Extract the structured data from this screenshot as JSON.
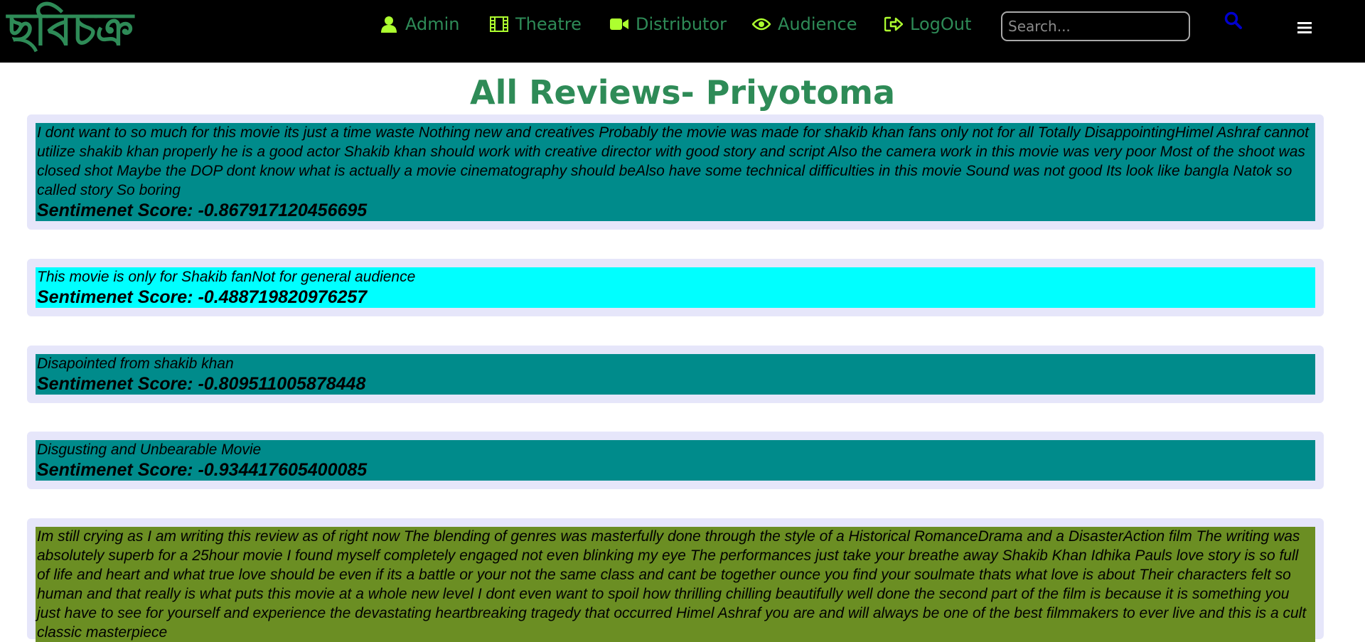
{
  "navbar": {
    "logo": "ছবিচক্র",
    "items": [
      {
        "label": "Admin",
        "icon": "user-icon"
      },
      {
        "label": "Theatre",
        "icon": "film-icon"
      },
      {
        "label": "Distributor",
        "icon": "video-camera-icon"
      },
      {
        "label": "Audience",
        "icon": "eye-icon"
      },
      {
        "label": "LogOut",
        "icon": "sign-out-icon"
      }
    ],
    "search": {
      "placeholder": "Search...",
      "value": ""
    },
    "search_button_icon": "search-icon",
    "menu_icon": "hamburger-menu-icon"
  },
  "page": {
    "title": "All Reviews- Priyotoma"
  },
  "score_label": "Sentimenet Score:",
  "reviews": [
    {
      "text": "I dont want to so much for this movie its just a time waste Nothing new and creatives Probably the movie was made for shakib khan fans only not for all Totally DisappointingHimel Ashraf cannot utilize shakib khan properly he is a good actor Shakib khan should work with creative director with good story and script Also the camera work in this movie was very poor Most of the shoot was closed shot Maybe the DOP dont know what is actually a movie cinematography should beAlso have some technical difficulties in this movie Sound was not good Its look like bangla Natok so called story So boring",
      "score": "-0.867917120456695",
      "color": "#008b8b"
    },
    {
      "text": "This movie is only for Shakib fanNot for general audience",
      "score": "-0.488719820976257",
      "color": "#00ffff"
    },
    {
      "text": "Disapointed from shakib khan",
      "score": "-0.809511005878448",
      "color": "#008b8b"
    },
    {
      "text": "Disgusting and Unbearable Movie",
      "score": "-0.934417605400085",
      "color": "#008b8b"
    },
    {
      "text": "Im still crying as I am writing this review as of right now The blending of genres was masterfully done through the style of a Historical RomanceDrama and a DisasterAction film The writing was absolutely superb for a 25hour movie I found myself completely engaged not even blinking my eye The performances just take your breathe away Shakib Khan Idhika Pauls love story is so full of life and heart and what true love should be even if its a battle or your not the same class and cant be together ounce you find your soulmate thats what love is about Their characters felt so human and that really is what puts this movie at a whole new level I dont even want to spoil how thrilling chilling beautifully well done the second part of the film is because it is something you just have to see for yourself and experience the devastating heartbreaking tragedy that occurred Himel Ashraf you are and will always be one of the best filmmakers to ever live and this is a cult classic masterpiece",
      "score": "",
      "color": "#6b8e23"
    }
  ],
  "colors": {
    "navbar_bg": "#000000",
    "accent_green": "#2e8b57",
    "icon_green": "#adff2f",
    "search_icon_blue": "#0000cd",
    "card_bg": "#e6e6fa"
  }
}
